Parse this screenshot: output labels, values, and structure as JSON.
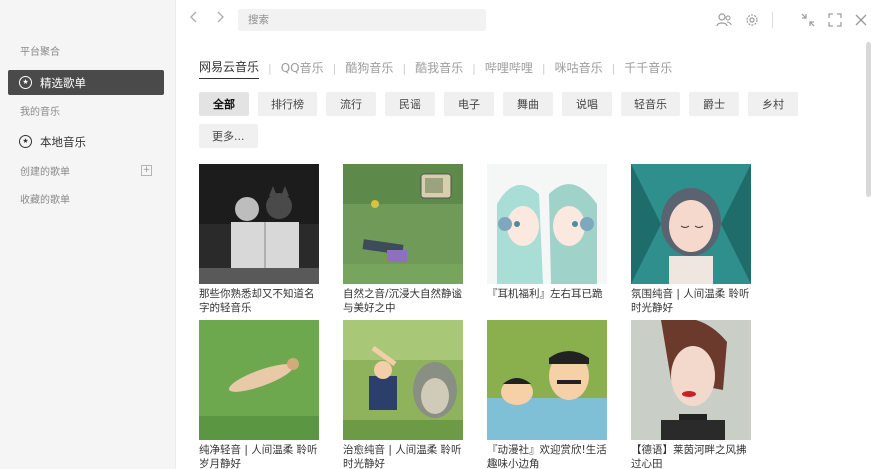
{
  "sidebar": {
    "platform_section": "平台聚合",
    "featured": "精选歌单",
    "my_music_section": "我的音乐",
    "local_music": "本地音乐",
    "created_playlists": "创建的歌单",
    "collected_playlists": "收藏的歌单"
  },
  "topbar": {
    "search_placeholder": "搜索",
    "back_icon": "chevron-left-icon",
    "forward_icon": "chevron-right-icon"
  },
  "platforms": [
    "网易云音乐",
    "QQ音乐",
    "酷狗音乐",
    "酷我音乐",
    "哔哩哔哩",
    "咪咕音乐",
    "千千音乐"
  ],
  "active_platform": 0,
  "categories": [
    "全部",
    "排行榜",
    "流行",
    "民谣",
    "电子",
    "舞曲",
    "说唱",
    "轻音乐",
    "爵士",
    "乡村",
    "更多..."
  ],
  "active_category": 0,
  "playlists": [
    {
      "title": "那些你熟悉却又不知道名字的轻音乐",
      "cover": "bw-children-book"
    },
    {
      "title": "自然之音/沉浸大自然静谧与美好之中",
      "cover": "grass-tv-legs"
    },
    {
      "title": "『耳机福利』左右耳已跪",
      "cover": "anime-twins-headphones"
    },
    {
      "title": "氛围纯音 | 人间温柔 聆听时光静好",
      "cover": "girl-teal-leaves"
    },
    {
      "title": "纯净轻音 | 人间温柔 聆听岁月静好",
      "cover": "person-lying-grass"
    },
    {
      "title": "治愈纯音 | 人间温柔 聆听时光静好",
      "cover": "boy-totoro-grass"
    },
    {
      "title": "『动漫社』欢迎赏欣!生活趣味小边角",
      "cover": "shinchan-bath"
    },
    {
      "title": "【德语】莱茵河畔之风拂过心田",
      "cover": "woman-red-lips"
    }
  ],
  "colors": {
    "sidebar_bg": "#f5f5f5",
    "active_item_bg": "#4a4a4a",
    "chip_bg": "#f0f0f0"
  }
}
